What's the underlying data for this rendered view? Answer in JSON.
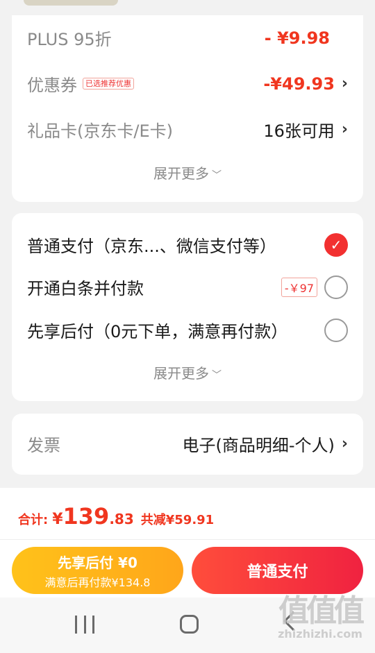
{
  "discounts": {
    "plus": {
      "label": "PLUS 95折",
      "value": "- ¥9.98"
    },
    "coupon": {
      "label": "优惠券",
      "tag": "已选推荐优惠",
      "value": "-¥49.93"
    },
    "gift_card": {
      "label": "礼品卡(京东卡/E卡)",
      "value": "16张可用"
    },
    "expand": "展开更多"
  },
  "payment": {
    "options": [
      {
        "label": "普通支付（京东...、微信支付等）",
        "selected": true
      },
      {
        "label": "开通白条并付款",
        "tag": "-￥97",
        "selected": false
      },
      {
        "label": "先享后付（0元下单，满意再付款）",
        "selected": false
      }
    ],
    "expand": "展开更多"
  },
  "invoice": {
    "label": "发票",
    "value": "电子(商品明细-个人)"
  },
  "footer": {
    "total_label": "合计:",
    "currency": "¥",
    "total_int": "139",
    "total_dec": ".83",
    "saved": "共减¥59.91",
    "later_line1": "先享后付 ¥0",
    "later_line2": "满意后再付款¥134.8",
    "pay_label": "普通支付"
  },
  "watermark": {
    "big": "值值值",
    "small": "zhizhizhi.com"
  },
  "colors": {
    "accent": "#f0361f",
    "later": "#ffb51a",
    "pay": "#f0304a"
  },
  "icons": {
    "chevron": "chevron-right-icon",
    "caret": "chevron-down-icon",
    "check": "check-icon"
  }
}
